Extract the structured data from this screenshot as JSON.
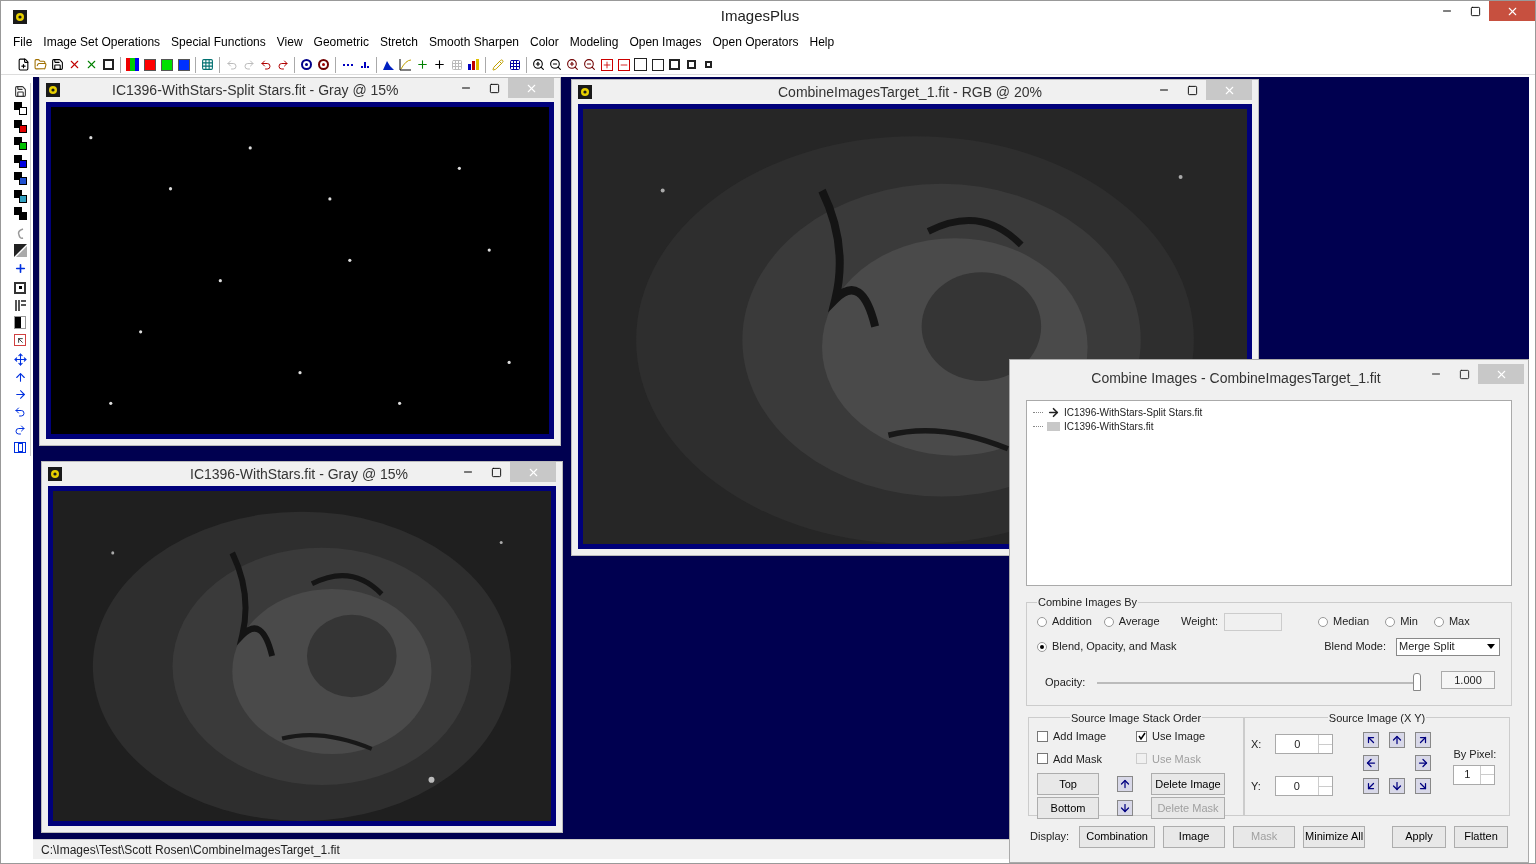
{
  "window": {
    "title": "ImagesPlus"
  },
  "menu": [
    "File",
    "Image Set Operations",
    "Special Functions",
    "View",
    "Geometric",
    "Stretch",
    "Smooth Sharpen",
    "Color",
    "Modeling",
    "Open Images",
    "Open Operators",
    "Help"
  ],
  "child_windows": [
    {
      "title": "IC1396-WithStars-Split Stars.fit - Gray @ 15%",
      "kind": "picture"
    },
    {
      "title": "IC1396-WithStars.fit - Gray @ 15%",
      "kind": "picture"
    },
    {
      "title": "CombineImagesTarget_1.fit - RGB @ 20%",
      "kind": "picture"
    }
  ],
  "status_bar": "C:\\Images\\Test\\Scott Rosen\\CombineImagesTarget_1.fit",
  "dialog": {
    "title": "Combine Images - CombineImagesTarget_1.fit",
    "layers": [
      {
        "name": "IC1396-WithStars-Split Stars.fit",
        "selected": true
      },
      {
        "name": "IC1396-WithStars.fit",
        "selected": false
      }
    ],
    "combine_group": {
      "title": "Combine Images By",
      "radios_left": [
        {
          "label": "Addition",
          "selected": false
        },
        {
          "label": "Average",
          "selected": false
        }
      ],
      "weight": {
        "label": "Weight:"
      },
      "radios_right": [
        {
          "label": "Median",
          "selected": false
        },
        {
          "label": "Min",
          "selected": false
        },
        {
          "label": "Max",
          "selected": false
        }
      ],
      "blend_radio": {
        "label": "Blend, Opacity, and Mask",
        "selected": true
      },
      "blend_mode": {
        "label": "Blend Mode:",
        "value": "Merge Split"
      },
      "opacity": {
        "label": "Opacity:",
        "level": 1,
        "reading": "1.000"
      }
    },
    "stack_group": {
      "title": "Source Image Stack Order",
      "checkboxes": [
        {
          "label": "Add Image",
          "checked": false,
          "disabled": false
        },
        {
          "label": "Use Image",
          "checked": true,
          "disabled": false
        },
        {
          "label": "Add Mask",
          "checked": false,
          "disabled": false
        },
        {
          "label": "Use Mask",
          "checked": false,
          "disabled": true
        }
      ],
      "buttons": [
        {
          "label": "Top",
          "disabled": false
        },
        {
          "label": "Delete Image",
          "disabled": false
        },
        {
          "label": "Bottom",
          "disabled": false
        },
        {
          "label": "Delete Mask",
          "disabled": true
        }
      ]
    },
    "position_group": {
      "title": "Source Image (X Y)",
      "x": {
        "label": "X:",
        "value": "0"
      },
      "y": {
        "label": "Y:",
        "value": "0"
      },
      "by_pixel": {
        "label": "By Pixel:",
        "value": "1"
      }
    },
    "display_label": "Display:",
    "display_buttons": [
      {
        "label": "Combination",
        "disabled": false
      },
      {
        "label": "Image",
        "disabled": false
      },
      {
        "label": "Mask",
        "disabled": true
      },
      {
        "label": "Minimize All",
        "disabled": false
      }
    ],
    "action_buttons": [
      {
        "label": "Apply",
        "disabled": false
      },
      {
        "label": "Flatten",
        "disabled": false
      }
    ]
  }
}
